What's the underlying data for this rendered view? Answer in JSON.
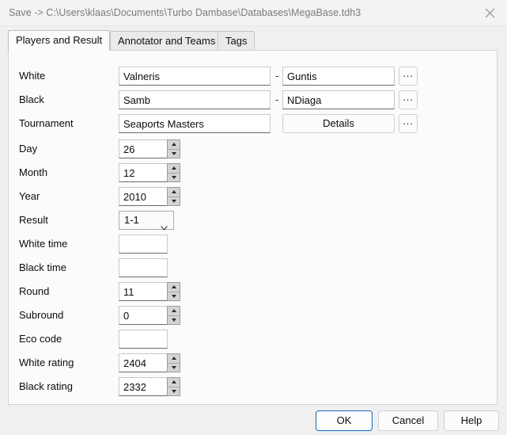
{
  "window": {
    "title": "Save -> C:\\Users\\klaas\\Documents\\Turbo Dambase\\Databases\\MegaBase.tdh3",
    "close_label": "close-icon"
  },
  "tabs": [
    {
      "label": "Players and Result",
      "selected": true
    },
    {
      "label": "Annotator and Teams",
      "selected": false
    },
    {
      "label": "Tags",
      "selected": false
    }
  ],
  "form": {
    "separator": "-",
    "dots_label": "...",
    "details_label": "Details",
    "rows": [
      {
        "label": "White",
        "value": "Valneris",
        "value2": "Guntis"
      },
      {
        "label": "Black",
        "value": "Samb",
        "value2": "NDiaga"
      },
      {
        "label": "Tournament",
        "value": "Seaports Masters"
      },
      {
        "label": "Day",
        "value": "26"
      },
      {
        "label": "Month",
        "value": "12"
      },
      {
        "label": "Year",
        "value": "2010"
      },
      {
        "label": "Result",
        "value": "1-1"
      },
      {
        "label": "White time",
        "value": ""
      },
      {
        "label": "Black time",
        "value": ""
      },
      {
        "label": "Round",
        "value": "11"
      },
      {
        "label": "Subround",
        "value": "0"
      },
      {
        "label": "Eco code",
        "value": ""
      },
      {
        "label": "White rating",
        "value": "2404"
      },
      {
        "label": "Black rating",
        "value": "2332"
      }
    ]
  },
  "footer": {
    "ok_label": "OK",
    "cancel_label": "Cancel",
    "help_label": "Help"
  },
  "colors": {
    "accent": "#0f6cbd",
    "panel": "#fbfbfb",
    "window": "#f0f0f0",
    "titlebar": "#f3f3f3"
  }
}
